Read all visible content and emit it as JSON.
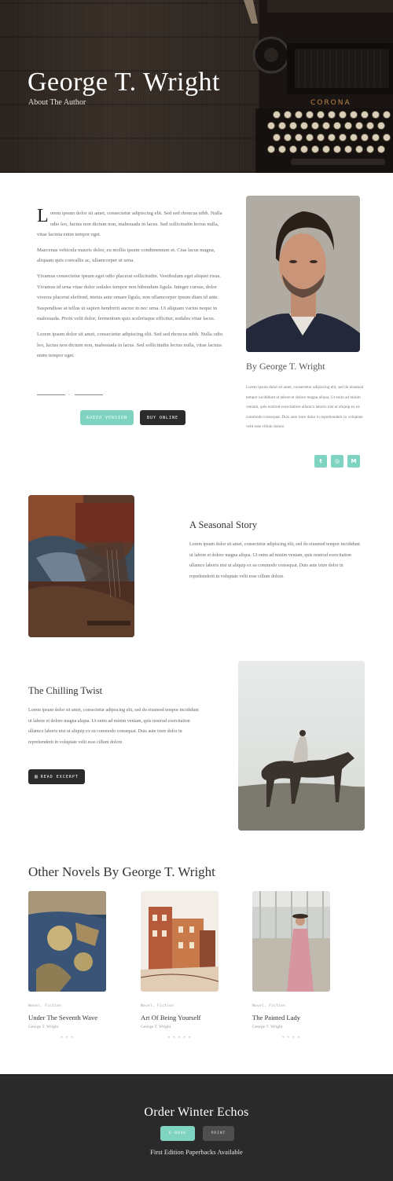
{
  "hero": {
    "title": "George T. Wright",
    "subtitle": "About The Author"
  },
  "about": {
    "dropcap": "L",
    "paragraph1": "orem ipsum dolor sit amet, consectetur adipiscing elit. Sed sed rhoncus nibh. Nulla odio leo, luctus non dictum non, malesuada in lacus. Sed sollicitudin lectus nulla, vitae lacinia enim tempor eget.",
    "paragraph2": "Maecenas vehicula mauris dolor, eu mollis ipsum condimentum et. Cras lacus magna, aliquam quis convallis ac, ullamcorper ut urna.",
    "paragraph3": "Vivamus consectetur ipsum eget odio placerat sollicitudin. Vestibulum eget aliquet risus. Vivamus id urna vitae dolor sodales tempor non bibendum ligula. Integer cursus, dolor viverra placerat eleifend, metus ante ornare ligula, non ullamcorper ipsum diam id ante. Suspendisse at tellus ut sapien hendrerit auctor in nec urna. Ut aliquam varius neque in malesuada. Proin velit dolor, fermentum quis scelerisque efficitur, sodales vitae lacus.",
    "paragraph4": "Lorem ipsum dolor sit amet, consectetur adipiscing elit. Sed sed rhoncus nibh. Nulla odio leo, luctus non dictum non, malesuada in lacus. Sed sollicitudin lectus nulla, vitae lacinia enim tempor eget.",
    "audio_button": "Audio Version",
    "buy_button": "Buy Online",
    "author_by": "By George T. Wright",
    "author_bio": "Lorem ipsum dolor sit amet, consectetur adipiscing elit, sed do eiusmod tempor incididunt ut labore et dolore magna aliqua. Ut enim ad minim veniam, quis nostrud exercitation ullamco laboris nisi ut aliquip ex ea commodo consequat. Duis aute irure dolor in reprehenderit in voluptate velit esse cillum dolore.",
    "social": [
      "twitter-icon",
      "dribbble-icon",
      "medium-icon"
    ]
  },
  "stories": {
    "seasonal_title": "A Seasonal Story",
    "seasonal_text": "Lorem ipsum dolor sit amet, consectetur adipiscing elit, sed do eiusmod tempor incididunt ut labore et dolore magna aliqua. Ut enim ad minim veniam, quis nostrud exercitation ullamco laboris nisi ut aliquip ex ea commodo consequat. Duis aute irure dolor in reprehenderit in voluptate velit esse cillum dolore.",
    "twist_title": "The Chilling Twist",
    "twist_text": "Lorem ipsum dolor sit amet, consectetur adipiscing elit, sed do eiusmod tempor incididunt ut labore et dolore magna aliqua. Ut enim ad minim veniam, quis nostrud exercitation ullamco laboris nisi ut aliquip ex ea commodo consequat. Duis aute irure dolor in reprehenderit in voluptate velit esse cillum dolore.",
    "read_button": "Read Excerpt"
  },
  "novels": {
    "section_title": "Other Novels By George T. Wright",
    "items": [
      {
        "genre": "Novel, Fiction",
        "title": "Under The Seventh Wave",
        "author": "George T. Wright",
        "stars": "★ ★ ★"
      },
      {
        "genre": "Novel, Fiction",
        "title": "Art Of Being Yourself",
        "author": "George T. Wright",
        "stars": "★ ★ ★ ★ ★"
      },
      {
        "genre": "Novel, Fiction",
        "title": "The Painted Lady",
        "author": "George T. Wright",
        "stars": "★ ★ ★ ★"
      }
    ]
  },
  "footer": {
    "title": "Order Winter Echos",
    "ebook_button": "E-Book",
    "print_button": "Print",
    "subtitle": "First Edition Paperbacks Available"
  },
  "colors": {
    "accent": "#7fd4c1",
    "dark": "#2b2b2b",
    "footer_bg": "#2a2a2a"
  }
}
